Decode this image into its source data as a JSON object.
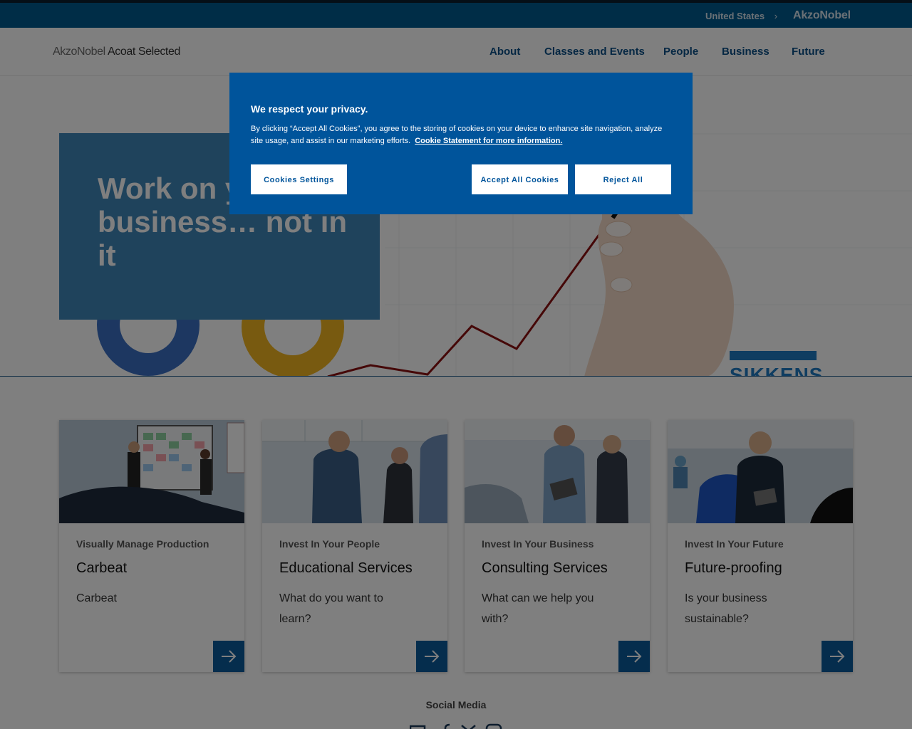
{
  "topbar": {
    "country_label": "United States",
    "country_chevron": "›",
    "brand_logo": "AkzoNobel"
  },
  "header": {
    "site_title_part1": "AkzoNobel",
    "site_title_part2": "Acoat Selected",
    "nav": [
      "About",
      "Classes and Events",
      "People",
      "Business",
      "Future"
    ]
  },
  "hero": {
    "title": "Work on your business… not in it",
    "brand_text": "SIKKENS"
  },
  "cards": [
    {
      "subtitle": "Visually Manage Production",
      "title": "Carbeat",
      "description": "Carbeat",
      "icon": "arrow-right-icon"
    },
    {
      "subtitle": "Invest In Your People",
      "title": "Educational Services",
      "description": "What do you want to learn?",
      "icon": "arrow-right-icon"
    },
    {
      "subtitle": "Invest In Your Business",
      "title": "Consulting Services",
      "description": "What can we help you with?",
      "icon": "arrow-right-icon"
    },
    {
      "subtitle": "Invest In Your Future",
      "title": "Future-proofing",
      "description": "Is your business sustainable?",
      "icon": "arrow-right-icon"
    }
  ],
  "social": {
    "title": "Social Media",
    "icons": [
      "email-icon",
      "facebook-icon",
      "x-icon",
      "instagram-icon"
    ]
  },
  "cookie_dialog": {
    "title": "We respect your privacy.",
    "text": "By clicking “Accept All Cookies”, you agree to the storing of cookies on your device to enhance site navigation, analyze site usage, and assist in our marketing efforts.",
    "link": "Cookie Statement for more information.",
    "settings_button": "Cookies Settings",
    "accept_button": "Accept All Cookies",
    "reject_button": "Reject All"
  },
  "colors": {
    "brand_blue": "#005b8e",
    "nav_blue": "#0b4f87",
    "dialog_blue": "#00549b",
    "card_button": "#0b5a9a"
  }
}
